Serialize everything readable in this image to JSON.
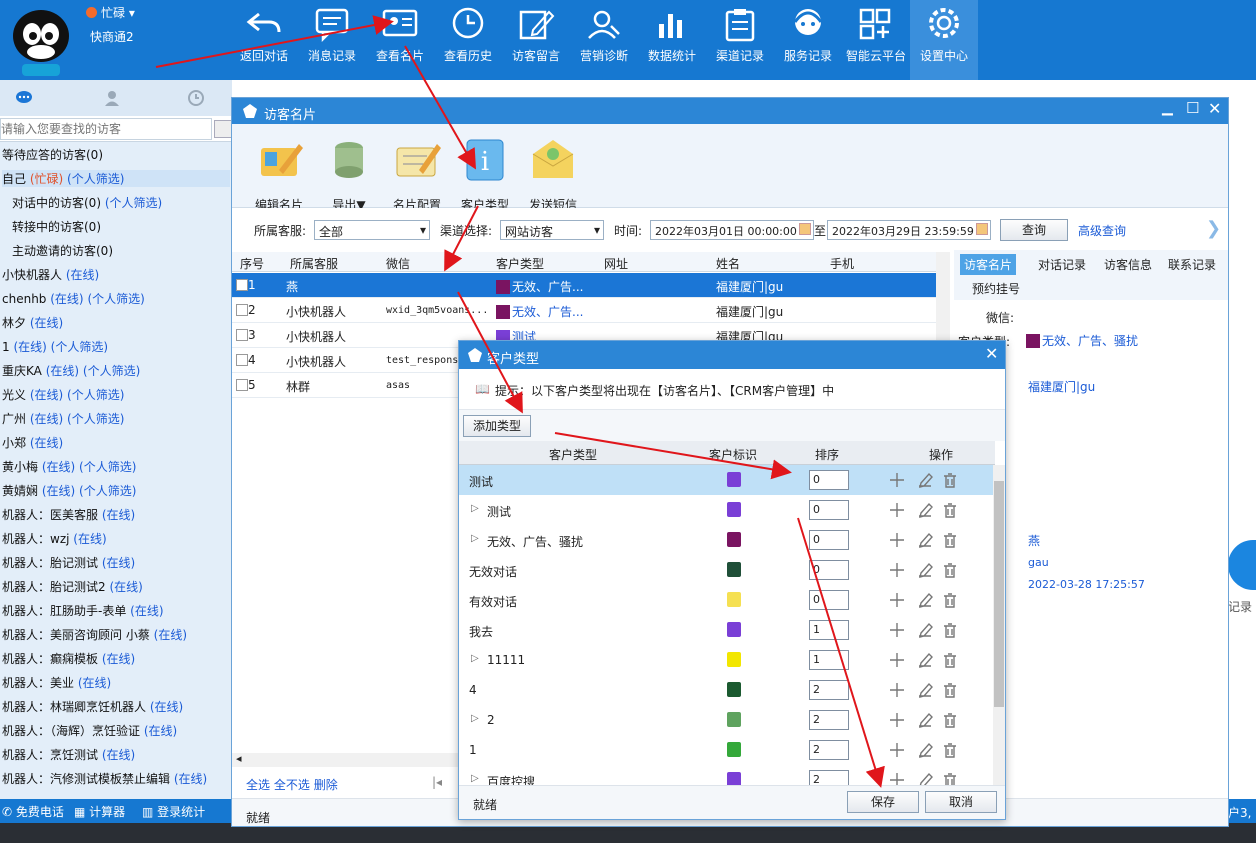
{
  "top": {
    "status": "忙碌",
    "brand": "快商通2",
    "buttons": [
      {
        "label": "返回对话",
        "icon": "undo-icon"
      },
      {
        "label": "消息记录",
        "icon": "message-icon"
      },
      {
        "label": "查看名片",
        "icon": "card-icon"
      },
      {
        "label": "查看历史",
        "icon": "clock-icon"
      },
      {
        "label": "访客留言",
        "icon": "edit-icon"
      },
      {
        "label": "营销诊断",
        "icon": "diagnosis-icon"
      },
      {
        "label": "数据统计",
        "icon": "bar-chart-icon"
      },
      {
        "label": "渠道记录",
        "icon": "clipboard-icon"
      },
      {
        "label": "服务记录",
        "icon": "headset-icon"
      },
      {
        "label": "智能云平台",
        "icon": "grid-icon"
      },
      {
        "label": "设置中心",
        "icon": "gear-icon"
      }
    ]
  },
  "left": {
    "search_placeholder": "请输入您要查找的访客",
    "items": [
      {
        "text": "等待应答的访客(0)"
      },
      {
        "text": "自己 ",
        "busy": "(忙碌)",
        "flt": "(个人筛选)"
      },
      {
        "text": "对话中的访客(0)",
        "flt": "(个人筛选)",
        "indent": true
      },
      {
        "text": "转接中的访客(0)",
        "indent": true
      },
      {
        "text": "主动邀请的访客(0)",
        "indent": true
      },
      {
        "text": "小快机器人 ",
        "on": "(在线)"
      },
      {
        "text": "chenhb ",
        "on": "(在线)",
        "flt": "(个人筛选)"
      },
      {
        "text": "林夕 ",
        "on": "(在线)"
      },
      {
        "text": "1 ",
        "on": "(在线)",
        "flt": "(个人筛选)"
      },
      {
        "text": "重庆KA ",
        "on": "(在线)",
        "flt": "(个人筛选)"
      },
      {
        "text": "光义 ",
        "on": "(在线)",
        "flt": "(个人筛选)"
      },
      {
        "text": "广州 ",
        "on": "(在线)",
        "flt": "(个人筛选)"
      },
      {
        "text": "小郑 ",
        "on": "(在线)"
      },
      {
        "text": "黄小梅 ",
        "on": "(在线)",
        "flt": "(个人筛选)"
      },
      {
        "text": "黄婧娴 ",
        "on": "(在线)",
        "flt": "(个人筛选)"
      },
      {
        "text": "机器人：医美客服 ",
        "on": "(在线)"
      },
      {
        "text": "机器人：wzj       ",
        "on": "(在线)"
      },
      {
        "text": "机器人：胎记测试 ",
        "on": "(在线)"
      },
      {
        "text": "机器人：胎记测试2 ",
        "on": "(在线)"
      },
      {
        "text": "机器人：肛肠助手-表单         ",
        "on": "(在线)"
      },
      {
        "text": "机器人：美丽咨询顾问 小蔡    ",
        "on": "(在线)"
      },
      {
        "text": "机器人：癫痫模板 ",
        "on": "(在线)"
      },
      {
        "text": "机器人：美业 ",
        "on": "(在线)"
      },
      {
        "text": "机器人：林瑞卿烹饪机器人 ",
        "on": "(在线)"
      },
      {
        "text": "机器人：（海辉）烹饪验证 ",
        "on": "(在线)"
      },
      {
        "text": "机器人：烹饪测试 ",
        "on": "(在线)"
      },
      {
        "text": "机器人：汽修测试模板禁止编辑 ",
        "on": "(在线)"
      }
    ],
    "bottom": [
      "免费电话",
      "计算器",
      "登录统计"
    ]
  },
  "visitor": {
    "title": "访客名片",
    "tools": [
      "编辑名片",
      "导出▼",
      "名片配置",
      "客户类型",
      "发送短信"
    ],
    "filter": {
      "agent_label": "所属客服:",
      "agent_value": "全部",
      "channel_label": "渠道选择:",
      "channel_value": "网站访客",
      "time_label": "时间:",
      "time_from": "2022年03月01日  00:00:00",
      "time_sep": "至",
      "time_to": "2022年03月29日  23:59:59",
      "query": "查询",
      "advanced": "高级查询"
    },
    "columns": [
      "序号",
      "所属客服",
      "微信",
      "客户类型",
      "网址",
      "姓名",
      "手机"
    ],
    "rows": [
      {
        "no": "1",
        "agent": "燕",
        "wx": "",
        "type": "无效、广告...",
        "name": "福建厦门|gu"
      },
      {
        "no": "2",
        "agent": "小快机器人",
        "wx": "wxid_3qm5voans...",
        "type": "无效、广告...",
        "name": "福建厦门|gu"
      },
      {
        "no": "3",
        "agent": "小快机器人",
        "wx": "",
        "type": "测试",
        "name": "福建厦门|gu"
      },
      {
        "no": "4",
        "agent": "小快机器人",
        "wx": "test_respons",
        "type": "",
        "name": ""
      },
      {
        "no": "5",
        "agent": "林群",
        "wx": "asas",
        "type": "",
        "name": ""
      }
    ],
    "footer": {
      "all": "全选",
      "none": "全不选",
      "delete": "删除"
    },
    "status": "就绪",
    "right_tabs": [
      "访客名片",
      "对话记录",
      "访客信息",
      "联系记录",
      "预约挂号"
    ],
    "right_fields": {
      "wechat_label": "微信:",
      "type_label": "客户类型:",
      "type_value": "无效、广告、骚扰",
      "loc_value": "福建厦门|gu",
      "agent_value": "燕",
      "user_value": "gau",
      "time_value": "2022-03-28 17:25:57"
    },
    "side_text": "记录",
    "side_text2": "户3,"
  },
  "dialog": {
    "title": "客户类型",
    "hint": "提示：以下客户类型将出现在【访客名片】、【CRM客户管理】中",
    "add": "添加类型",
    "columns": [
      "客户类型",
      "客户标识",
      "排序",
      "操作"
    ],
    "rows": [
      {
        "name": "测试",
        "color": "#7a3fd6",
        "order": "0",
        "arrow": false,
        "hl": true
      },
      {
        "name": "测试",
        "color": "#7a3fd6",
        "order": "0",
        "arrow": true
      },
      {
        "name": "无效、广告、骚扰",
        "color": "#7a1461",
        "order": "0",
        "arrow": true
      },
      {
        "name": "无效对话",
        "color": "#1f4f38",
        "order": "0",
        "arrow": false
      },
      {
        "name": "有效对话",
        "color": "#f5e052",
        "order": "0",
        "arrow": false
      },
      {
        "name": "我去",
        "color": "#7a3fd6",
        "order": "1",
        "arrow": false
      },
      {
        "name": "11111",
        "color": "#f2e600",
        "order": "1",
        "arrow": true
      },
      {
        "name": "4",
        "color": "#1b5a30",
        "order": "2",
        "arrow": false
      },
      {
        "name": "2",
        "color": "#5fa35f",
        "order": "2",
        "arrow": true
      },
      {
        "name": "1",
        "color": "#34a83a",
        "order": "2",
        "arrow": false
      },
      {
        "name": "百度控搜",
        "color": "#7a3fd6",
        "order": "2",
        "arrow": true
      }
    ],
    "status": "就绪",
    "save": "保存",
    "cancel": "取消"
  }
}
